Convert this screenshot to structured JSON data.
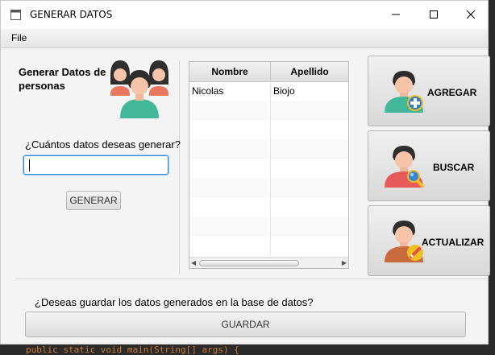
{
  "window": {
    "title": "GENERAR DATOS"
  },
  "menu": {
    "file": "File"
  },
  "left": {
    "heading": "Generar Datos de personas",
    "question": "¿Cuántos datos deseas generar?",
    "count_value": "",
    "generate_label": "GENERAR"
  },
  "table": {
    "columns": [
      "Nombre",
      "Apellido"
    ],
    "rows": [
      [
        "Nicolas",
        "Biojo"
      ],
      [
        "",
        ""
      ],
      [
        "",
        ""
      ],
      [
        "",
        ""
      ],
      [
        "",
        ""
      ],
      [
        "",
        ""
      ],
      [
        "",
        ""
      ],
      [
        "",
        ""
      ],
      [
        "",
        ""
      ]
    ]
  },
  "actions": {
    "add_label": "AGREGAR",
    "search_label": "BUSCAR",
    "update_label": "ACTUALIZAR"
  },
  "footer": {
    "question": "¿Deseas guardar los datos generados en la base de datos?",
    "save_label": "GUARDAR"
  },
  "background_code": "public static void main(String[] args) {",
  "colors": {
    "focus": "#2a8bd8",
    "window_bg": "#f4f4f4",
    "add_badge": "#2e7dd7",
    "search_badge": "#f0c020",
    "update_badge": "#e8a020"
  },
  "icons": [
    "app-icon",
    "minimize-icon",
    "maximize-icon",
    "close-icon",
    "people-group-icon",
    "user-add-icon",
    "user-search-icon",
    "user-edit-icon"
  ]
}
